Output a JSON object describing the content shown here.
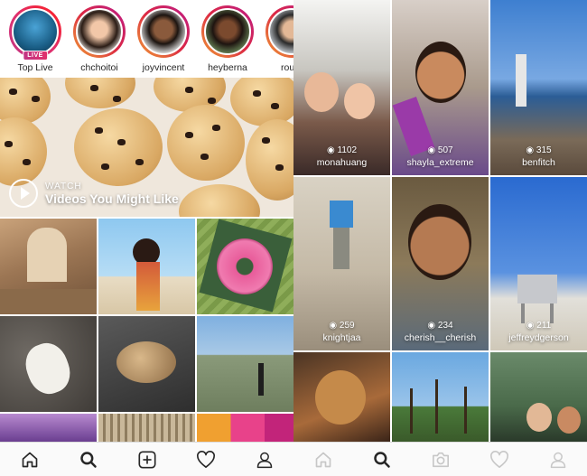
{
  "stories": [
    {
      "name": "Top Live",
      "live": true,
      "badge": "LIVE"
    },
    {
      "name": "chchoitoi",
      "live": false
    },
    {
      "name": "joyvincent",
      "live": false
    },
    {
      "name": "heyberna",
      "live": false
    },
    {
      "name": "rourk",
      "live": false
    }
  ],
  "watch": {
    "label": "WATCH",
    "title": "Videos You Might Like"
  },
  "live_tiles": [
    {
      "views": "1102",
      "user": "monahuang"
    },
    {
      "views": "507",
      "user": "shayla_extreme"
    },
    {
      "views": "315",
      "user": "benfitch"
    },
    {
      "views": "259",
      "user": "knightjaa"
    },
    {
      "views": "234",
      "user": "cherish__cherish"
    },
    {
      "views": "211",
      "user": "jeffreydgerson"
    }
  ],
  "tabbar_left": [
    "home-icon",
    "search-icon",
    "add-icon",
    "heart-icon",
    "profile-icon"
  ],
  "tabbar_right": [
    "home-icon",
    "search-icon",
    "camera-icon",
    "heart-icon",
    "profile-icon"
  ],
  "colors": {
    "accent": "#e1306c",
    "tab_active": "#262626",
    "tab_inactive": "#c7c7c7"
  }
}
